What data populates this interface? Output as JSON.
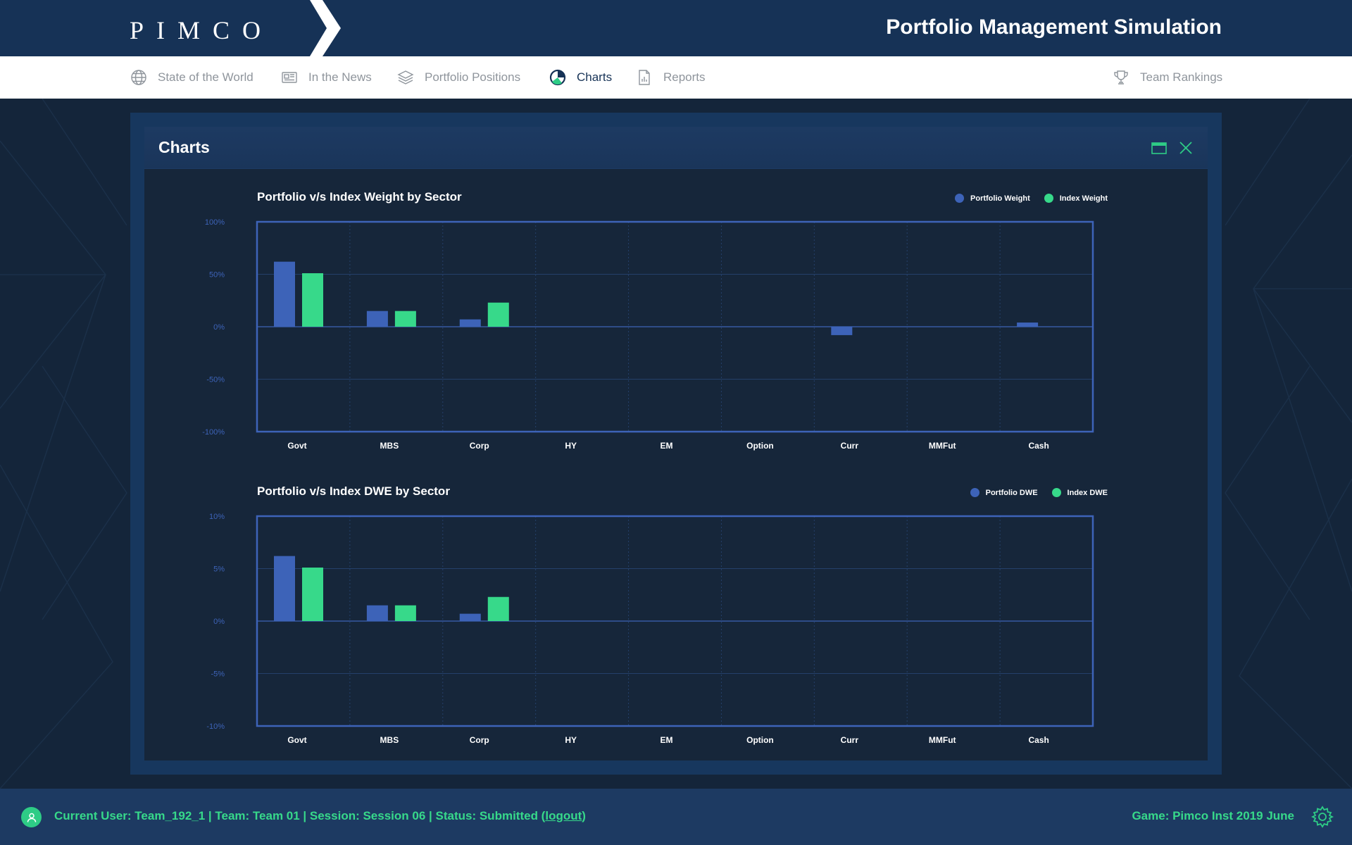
{
  "header": {
    "logo": "PIMCO",
    "title": "Portfolio Management Simulation"
  },
  "nav": {
    "items": [
      {
        "label": "State of the World",
        "icon": "globe-icon"
      },
      {
        "label": "In the News",
        "icon": "newspaper-icon"
      },
      {
        "label": "Portfolio Positions",
        "icon": "layers-icon"
      },
      {
        "label": "Charts",
        "icon": "pie-chart-icon",
        "active": true
      },
      {
        "label": "Reports",
        "icon": "report-icon"
      }
    ],
    "rankings": {
      "label": "Team Rankings",
      "icon": "trophy-icon"
    }
  },
  "panel": {
    "title": "Charts"
  },
  "colors": {
    "portfolio": "#3d63b8",
    "index": "#37d98a",
    "accent": "#2ecc86",
    "axis_border": "#3d63b8"
  },
  "chart_data": [
    {
      "type": "bar",
      "title": "Portfolio v/s Index Weight by Sector",
      "categories": [
        "Govt",
        "MBS",
        "Corp",
        "HY",
        "EM",
        "Option",
        "Curr",
        "MMFut",
        "Cash"
      ],
      "series": [
        {
          "name": "Portfolio Weight",
          "values": [
            62,
            15,
            7,
            0,
            0,
            0,
            -8,
            0,
            4
          ]
        },
        {
          "name": "Index Weight",
          "values": [
            51,
            15,
            23,
            0,
            0,
            0,
            0,
            0,
            0
          ]
        }
      ],
      "yticks": [
        "100%",
        "50%",
        "0%",
        "-50%",
        "-100%"
      ],
      "ylim": [
        -100,
        100
      ],
      "legend": "top-right",
      "grid": true
    },
    {
      "type": "bar",
      "title": "Portfolio v/s Index DWE by Sector",
      "categories": [
        "Govt",
        "MBS",
        "Corp",
        "HY",
        "EM",
        "Option",
        "Curr",
        "MMFut",
        "Cash"
      ],
      "series": [
        {
          "name": "Portfolio DWE",
          "values": [
            6.2,
            1.5,
            0.7,
            0,
            0,
            0,
            0,
            0,
            0
          ]
        },
        {
          "name": "Index DWE",
          "values": [
            5.1,
            1.5,
            2.3,
            0,
            0,
            0,
            0,
            0,
            0
          ]
        }
      ],
      "yticks": [
        "10%",
        "5%",
        "0%",
        "-5%",
        "-10%"
      ],
      "ylim": [
        -10,
        10
      ],
      "legend": "top-right",
      "grid": true
    }
  ],
  "footer": {
    "status": "Current User: Team_192_1 | Team: Team 01 | Session: Session 06 | Status: Submitted (",
    "logout": "logout",
    "status_end": ")",
    "game": "Game: Pimco Inst 2019 June"
  }
}
